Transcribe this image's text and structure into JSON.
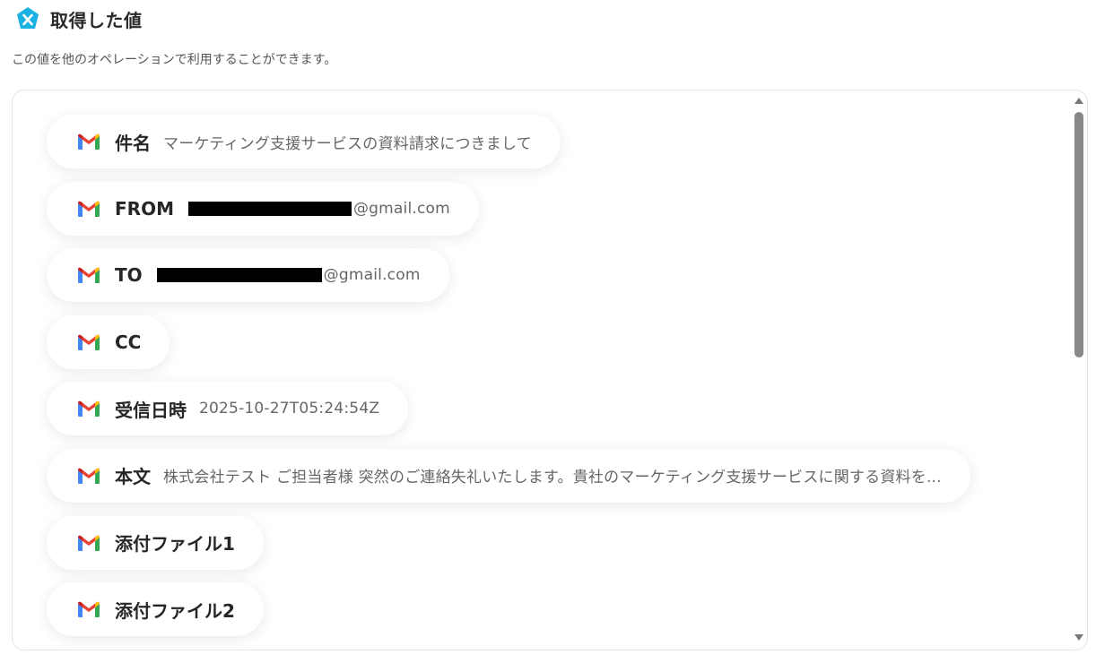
{
  "header": {
    "title": "取得した値",
    "subtitle": "この値を他のオペレーションで利用することができます。",
    "icon": "yoom-x-icon",
    "accent_color": "#1ab2e2"
  },
  "items": [
    {
      "label": "件名",
      "value": "マーケティング支援サービスの資料請求につきまして",
      "redacted": false
    },
    {
      "label": "FROM",
      "value": "@gmail.com",
      "redacted": true
    },
    {
      "label": "TO",
      "value": "@gmail.com",
      "redacted": true
    },
    {
      "label": "CC",
      "value": "",
      "redacted": false
    },
    {
      "label": "受信日時",
      "value": "2025-10-27T05:24:54Z",
      "redacted": false
    },
    {
      "label": "本文",
      "value": "株式会社テスト ご担当者様 突然のご連絡失礼いたします。貴社のマーケティング支援サービスに関する資料を...",
      "redacted": false
    },
    {
      "label": "添付ファイル1",
      "value": "",
      "redacted": false
    },
    {
      "label": "添付ファイル2",
      "value": "",
      "redacted": false
    }
  ],
  "item_icon": "gmail-icon"
}
